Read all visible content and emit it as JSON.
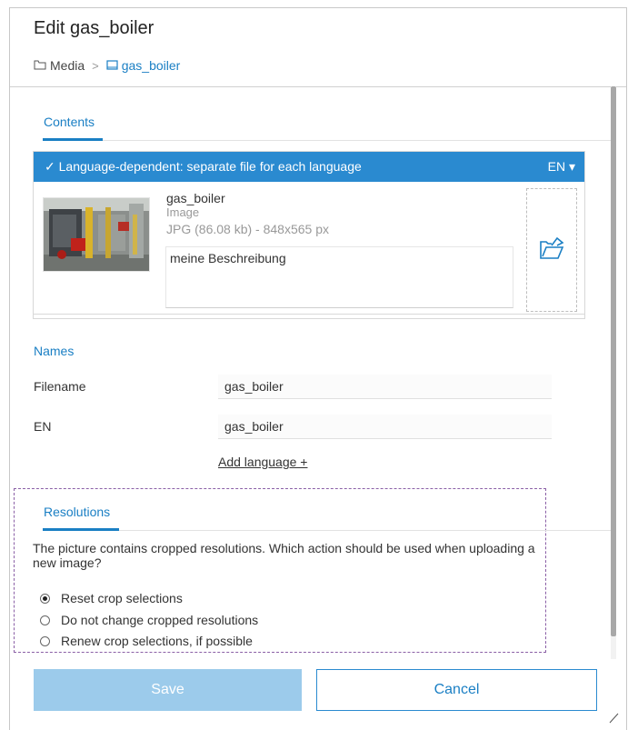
{
  "dialog": {
    "title": "Edit gas_boiler",
    "breadcrumb": {
      "root": "Media",
      "current": "gas_boiler"
    }
  },
  "tabs": {
    "contents": "Contents",
    "resolutions": "Resolutions"
  },
  "language_bar": {
    "label": "✓ Language-dependent: separate file for each language",
    "language": "EN ▾"
  },
  "file": {
    "name": "gas_boiler",
    "type": "Image",
    "info": "JPG (86.08 kb) - 848x565 px",
    "description": "meine Beschreibung"
  },
  "names": {
    "title": "Names",
    "fields": [
      {
        "label": "Filename",
        "value": "gas_boiler"
      },
      {
        "label": "EN",
        "value": "gas_boiler"
      }
    ],
    "add_language": "Add language +"
  },
  "resolutions": {
    "question": "The picture contains cropped resolutions. Which action should be used when uploading a new image?",
    "options": [
      {
        "label": "Reset crop selections",
        "checked": true
      },
      {
        "label": "Do not change cropped resolutions",
        "checked": false
      },
      {
        "label": "Renew crop selections, if possible",
        "checked": false
      }
    ]
  },
  "buttons": {
    "save": "Save",
    "cancel": "Cancel"
  },
  "icons": {
    "folder": "folder-icon",
    "image_file": "image-file-icon",
    "upload": "folder-upload-icon",
    "language_dropdown": "chevron-down-icon"
  },
  "colors": {
    "accent": "#1a7fc4",
    "bar": "#2a8ad0",
    "save_disabled": "#9ccbeb",
    "highlight_border": "#8a5fa6"
  }
}
